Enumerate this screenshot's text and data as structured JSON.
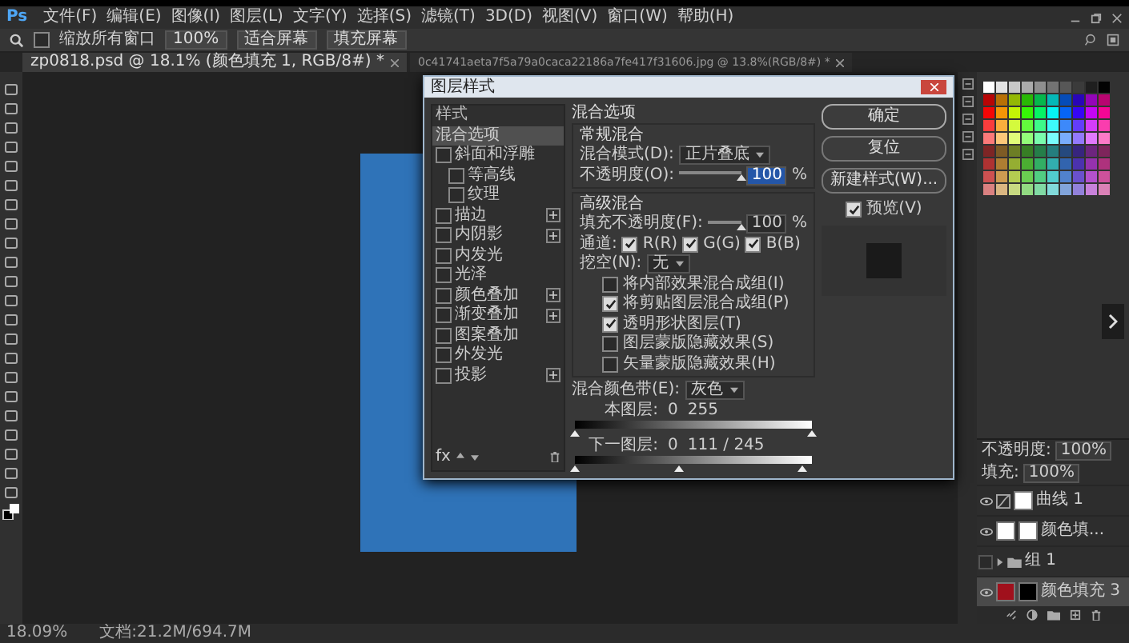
{
  "app": {
    "logo": "Ps"
  },
  "menu": [
    "文件(F)",
    "编辑(E)",
    "图像(I)",
    "图层(L)",
    "文字(Y)",
    "选择(S)",
    "滤镜(T)",
    "3D(D)",
    "视图(V)",
    "窗口(W)",
    "帮助(H)"
  ],
  "options_bar": {
    "resize_windows": {
      "label": "缩放所有窗口",
      "checked": false
    },
    "buttons": [
      "100%",
      "适合屏幕",
      "填充屏幕"
    ]
  },
  "tabs": [
    {
      "label": "zp0818.psd @ 18.1% (颜色填充 1, RGB/8#) *",
      "selected": true
    },
    {
      "label": "0c41741aeta7f5a79a0caca22186a7fe417f31606.jpg @ 13.8%(RGB/8#) *",
      "selected": false
    }
  ],
  "dialog": {
    "title": "图层样式",
    "styles": [
      {
        "label": "样式",
        "kind": "header",
        "selected": false
      },
      {
        "label": "混合选项",
        "kind": "option",
        "selected": true
      },
      {
        "label": "斜面和浮雕",
        "kind": "effect",
        "checked": false,
        "selected": false,
        "addable": false,
        "children": [
          {
            "label": "等高线",
            "checked": false,
            "selected": false
          },
          {
            "label": "纹理",
            "checked": false,
            "selected": false
          }
        ]
      },
      {
        "label": "描边",
        "kind": "effect",
        "checked": false,
        "selected": false,
        "addable": true
      },
      {
        "label": "内阴影",
        "kind": "effect",
        "checked": false,
        "selected": false,
        "addable": true
      },
      {
        "label": "内发光",
        "kind": "effect",
        "checked": false,
        "selected": false,
        "addable": false
      },
      {
        "label": "光泽",
        "kind": "effect",
        "checked": false,
        "selected": false,
        "addable": false
      },
      {
        "label": "颜色叠加",
        "kind": "effect",
        "checked": false,
        "selected": false,
        "addable": true
      },
      {
        "label": "渐变叠加",
        "kind": "effect",
        "checked": false,
        "selected": false,
        "addable": true
      },
      {
        "label": "图案叠加",
        "kind": "effect",
        "checked": false,
        "selected": false,
        "addable": false
      },
      {
        "label": "外发光",
        "kind": "effect",
        "checked": false,
        "selected": false,
        "addable": false
      },
      {
        "label": "投影",
        "kind": "effect",
        "checked": false,
        "selected": false,
        "addable": true
      }
    ],
    "footer_fx": "fx",
    "blending": {
      "title": "混合选项",
      "general": {
        "title": "常规混合",
        "mode": {
          "label": "混合模式(D):",
          "value": "正片叠底"
        },
        "opacity": {
          "label": "不透明度(O):",
          "value": "100",
          "unit": "%",
          "level": 1
        }
      },
      "advanced": {
        "title": "高级混合",
        "fill_opacity": {
          "label": "填充不透明度(F):",
          "value": "100",
          "unit": "%",
          "level": 1
        },
        "channels": {
          "label": "通道:",
          "items": [
            {
              "label": "R(R)",
              "checked": true
            },
            {
              "label": "G(G)",
              "checked": true
            },
            {
              "label": "B(B)",
              "checked": true
            }
          ]
        },
        "knockout": {
          "label": "挖空(N):",
          "value": "无"
        },
        "options": [
          {
            "label": "将内部效果混合成组(I)",
            "checked": false
          },
          {
            "label": "将剪贴图层混合成组(P)",
            "checked": true
          },
          {
            "label": "透明形状图层(T)",
            "checked": true
          },
          {
            "label": "图层蒙版隐藏效果(S)",
            "checked": false
          },
          {
            "label": "矢量蒙版隐藏效果(H)",
            "checked": false
          }
        ]
      },
      "blend_if": {
        "label": "混合颜色带(E):",
        "value": "灰色",
        "bands": [
          {
            "label": "本图层:",
            "readings": [
              "0",
              "255"
            ],
            "thumbs": [
              {
                "level": 0
              },
              {
                "level": 1
              }
            ]
          },
          {
            "label": "下一图层:",
            "readings": [
              "0",
              "111 / 245"
            ],
            "thumbs": [
              {
                "level": 0
              },
              {
                "level": 0.44
              },
              {
                "level": 0.96
              }
            ]
          }
        ]
      }
    },
    "buttons": [
      {
        "label": "确定",
        "kind": "primary"
      },
      {
        "label": "复位",
        "kind": "normal"
      },
      {
        "label": "新建样式(W)...",
        "kind": "normal"
      }
    ],
    "preview": {
      "label": "预览(V)",
      "checked": true
    }
  },
  "layers_panel": {
    "opacity": {
      "label": "不透明度:",
      "value": "100%"
    },
    "fill": {
      "label": "填充:",
      "value": "100%"
    },
    "layers": [
      {
        "name": "曲线 1",
        "kind": "adjustment",
        "visible": true,
        "selected": false
      },
      {
        "name": "颜色填...",
        "kind": "fill",
        "visible": true,
        "selected": false,
        "color": "#ffffff"
      },
      {
        "name": "组 1",
        "kind": "group",
        "visible": false,
        "selected": false,
        "expanded": false
      },
      {
        "name": "颜色填充 3",
        "kind": "fill",
        "visible": true,
        "selected": true,
        "color": "#a0101c"
      }
    ]
  },
  "status_bar": {
    "zoom": "18.09%",
    "document": "文档:21.2M/694.7M"
  }
}
